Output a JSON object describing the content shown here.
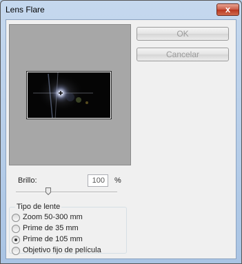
{
  "window": {
    "title": "Lens Flare",
    "close_glyph": "x"
  },
  "buttons": {
    "ok": "OK",
    "cancel": "Cancelar"
  },
  "brightness": {
    "label": "Brillo:",
    "value": "100",
    "unit": "%",
    "slider_fraction": 0.33
  },
  "lens_type": {
    "legend": "Tipo de lente",
    "options": [
      {
        "label": "Zoom 50-300 mm",
        "checked": false
      },
      {
        "label": "Prime de 35 mm",
        "checked": false
      },
      {
        "label": "Prime de 105 mm",
        "checked": true
      },
      {
        "label": "Objetivo fijo de película",
        "checked": false
      }
    ]
  },
  "icons": {
    "close": "close-icon",
    "crosshair": "crosshair-icon",
    "slider_thumb": "slider-thumb-icon"
  }
}
